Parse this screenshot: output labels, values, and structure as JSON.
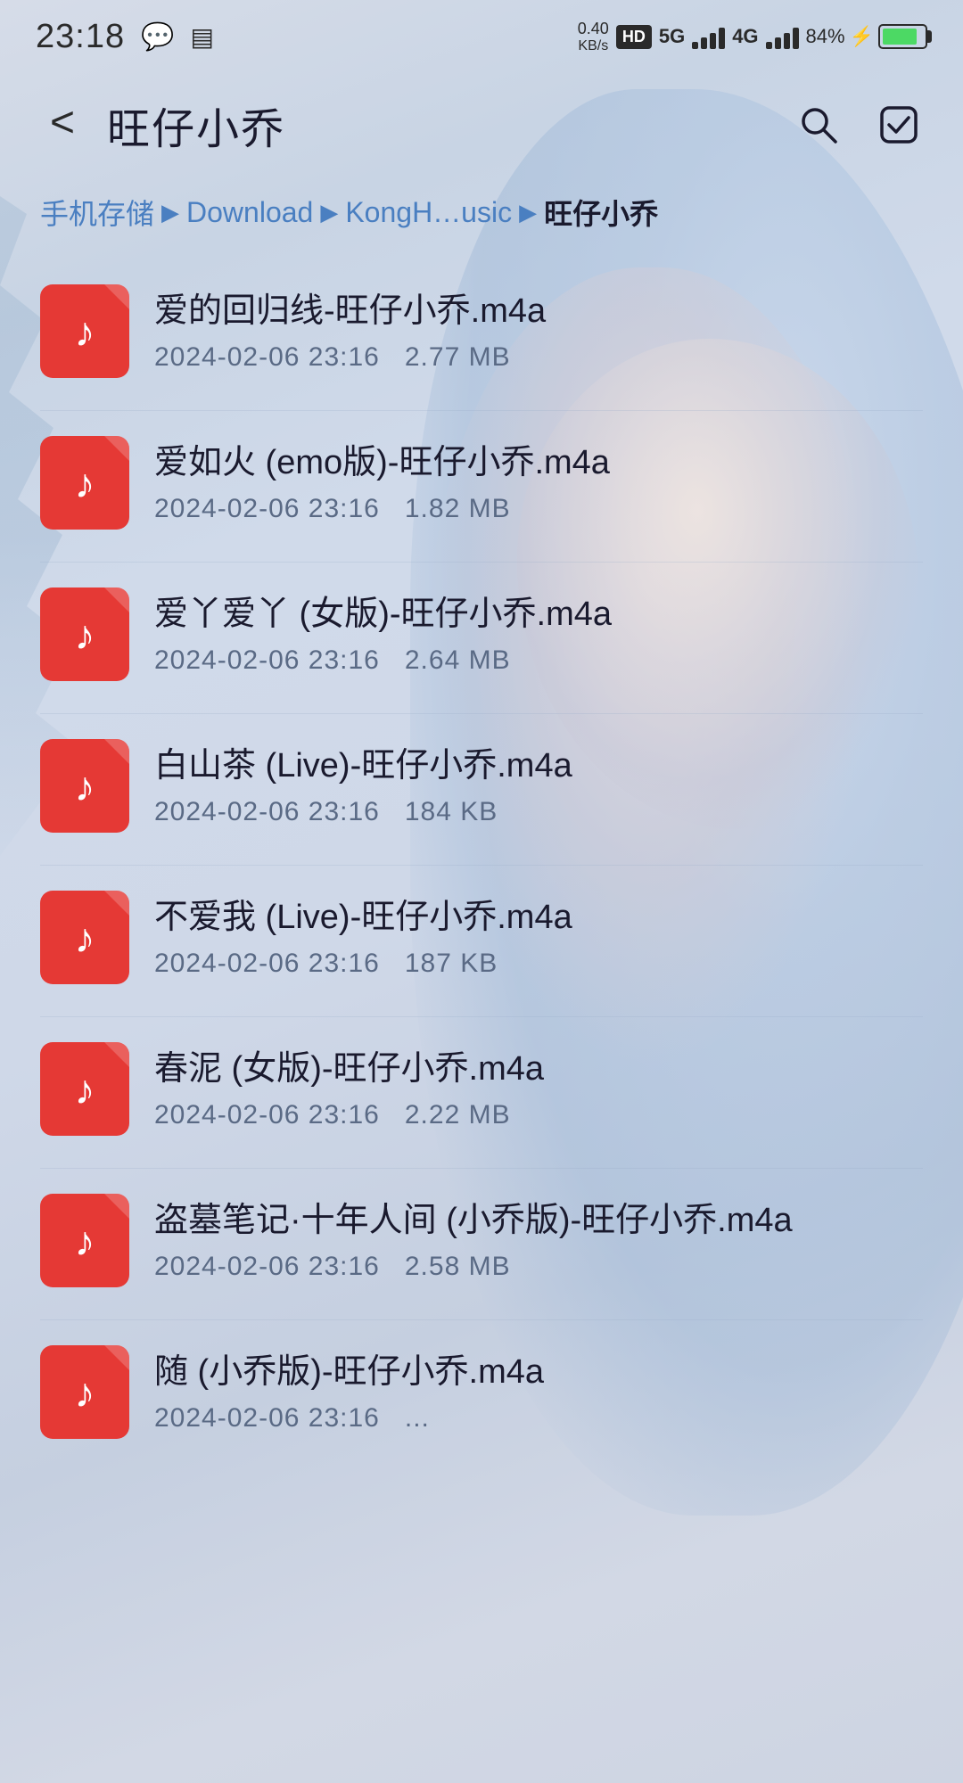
{
  "statusBar": {
    "time": "23:18",
    "speed": "0.40\nKB/s",
    "hd": "HD",
    "network5g": "5G",
    "network4g": "4G",
    "battery": "84%"
  },
  "header": {
    "title": "旺仔小乔",
    "backLabel": "<",
    "searchLabel": "search",
    "checkboxLabel": "checkbox"
  },
  "breadcrumb": {
    "items": [
      {
        "label": "手机存储",
        "isCurrent": false
      },
      {
        "label": "Download",
        "isCurrent": false
      },
      {
        "label": "KongH…usic",
        "isCurrent": false
      },
      {
        "label": "旺仔小乔",
        "isCurrent": true
      }
    ]
  },
  "files": [
    {
      "name": "爱的回归线-旺仔小乔.m4a",
      "date": "2024-02-06 23:16",
      "size": "2.77 MB"
    },
    {
      "name": "爱如火 (emo版)-旺仔小乔.m4a",
      "date": "2024-02-06 23:16",
      "size": "1.82 MB"
    },
    {
      "name": "爱丫爱丫 (女版)-旺仔小乔.m4a",
      "date": "2024-02-06 23:16",
      "size": "2.64 MB"
    },
    {
      "name": "白山茶 (Live)-旺仔小乔.m4a",
      "date": "2024-02-06 23:16",
      "size": "184 KB"
    },
    {
      "name": "不爱我 (Live)-旺仔小乔.m4a",
      "date": "2024-02-06 23:16",
      "size": "187 KB"
    },
    {
      "name": "春泥 (女版)-旺仔小乔.m4a",
      "date": "2024-02-06 23:16",
      "size": "2.22 MB"
    },
    {
      "name": "盗墓笔记·十年人间 (小乔版)-旺仔小乔.m4a",
      "date": "2024-02-06 23:16",
      "size": "2.58 MB"
    },
    {
      "name": "随 (小乔版)-旺仔小乔.m4a",
      "date": "2024-02-06 23:16",
      "size": "..."
    }
  ]
}
